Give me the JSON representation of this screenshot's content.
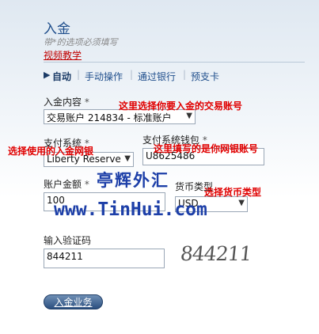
{
  "page": {
    "title": "入金",
    "required_note": "带*的选项必须填写",
    "video_link": "视频教学"
  },
  "tabs": [
    {
      "label": "自动",
      "active": true
    },
    {
      "label": "手动操作",
      "active": false
    },
    {
      "label": "通过银行",
      "active": false
    },
    {
      "label": "预支卡",
      "active": false
    }
  ],
  "form": {
    "deposit_content": {
      "label": "入金内容",
      "required": "*",
      "value": "交易账户 214834 - 标准账户"
    },
    "payment_system": {
      "label": "支付系统",
      "required": "*",
      "value": "Liberty Reserve"
    },
    "wallet": {
      "label": "支付系统钱包",
      "required": "*",
      "value": "U8625486"
    },
    "amount": {
      "label": "账户金额",
      "required": "*",
      "value": "100"
    },
    "currency": {
      "label": "货币类型",
      "value": "USD"
    },
    "captcha": {
      "label": "输入验证码",
      "value": "844211",
      "image_text": "844211"
    },
    "submit_label": "入金业务"
  },
  "annotations": {
    "account": "这里选择你要入金的交易账号",
    "bank": "选择使用的入金网银",
    "wallet": "这里填写的是你网银账号",
    "currency": "选择货币类型"
  },
  "watermark": {
    "chinese": "亭辉外汇",
    "url": "www.TinHui.com"
  },
  "colors": {
    "annotation": "#e00000",
    "watermark": "#1d3fa8",
    "title": "#1f4e8c"
  }
}
